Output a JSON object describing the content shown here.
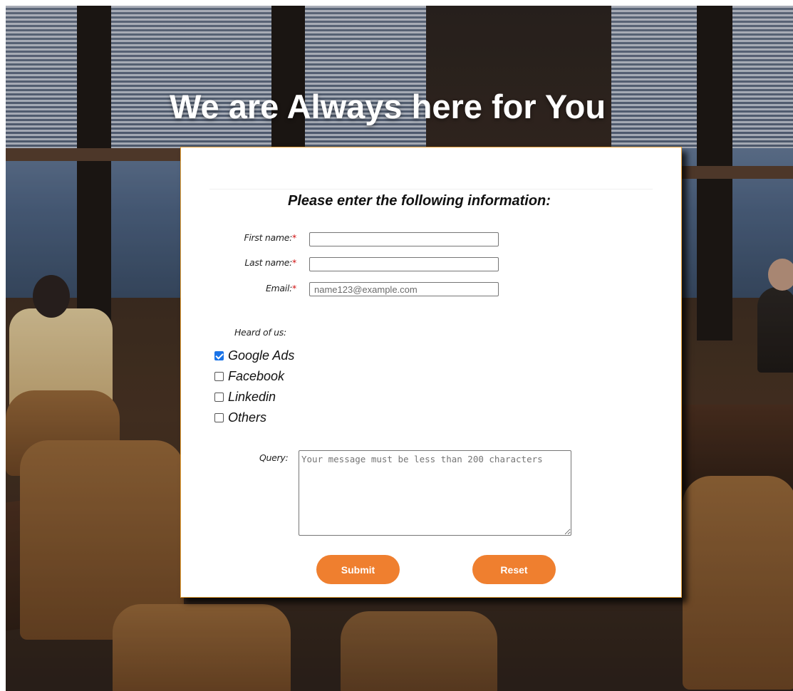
{
  "page": {
    "headline": "We are Always here for You"
  },
  "form": {
    "title": "Please enter the following information:",
    "first_name": {
      "label": "First name:",
      "required_mark": "*",
      "value": "",
      "placeholder": ""
    },
    "last_name": {
      "label": "Last name:",
      "required_mark": "*",
      "value": "",
      "placeholder": ""
    },
    "email": {
      "label": "Email:",
      "required_mark": "*",
      "value": "",
      "placeholder": "name123@example.com"
    },
    "heard_label": "Heard of us:",
    "heard_options": [
      {
        "label": "Google Ads",
        "checked": true
      },
      {
        "label": "Facebook",
        "checked": false
      },
      {
        "label": "Linkedin",
        "checked": false
      },
      {
        "label": "Others",
        "checked": false
      }
    ],
    "query": {
      "label": "Query:",
      "value": "",
      "placeholder": "Your message must be less than 200 characters"
    },
    "submit_label": "Submit",
    "reset_label": "Reset"
  },
  "colors": {
    "accent": "#ef7f2f",
    "card_border": "#e8a23a",
    "required": "#d01010",
    "checkbox_checked": "#1a73e8"
  },
  "background_image": "restaurant-interior"
}
